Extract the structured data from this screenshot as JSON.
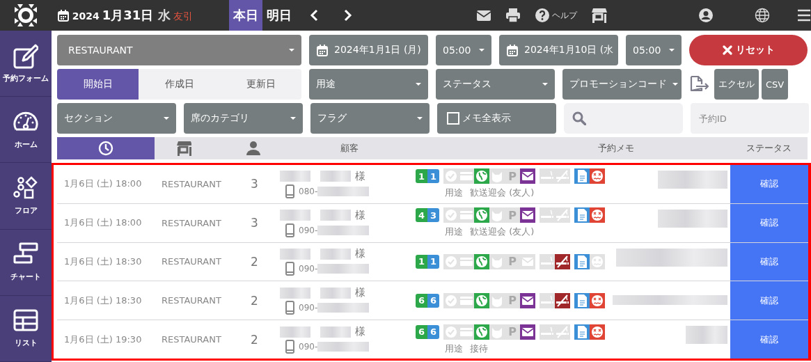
{
  "topbar": {
    "year": "2024",
    "date": "1月31日",
    "weekday": "水",
    "rokuyo": "友引",
    "day_buttons": [
      {
        "label": "本日",
        "selected": true
      },
      {
        "label": "明日",
        "selected": false
      }
    ],
    "help": "ヘルプ"
  },
  "sidebar": {
    "items": [
      {
        "kind": "form",
        "label": "予約フォーム"
      },
      {
        "kind": "home",
        "label": "ホーム"
      },
      {
        "kind": "floor",
        "label": "フロア"
      },
      {
        "kind": "chart",
        "label": "チャート"
      },
      {
        "kind": "list",
        "label": "リスト"
      }
    ]
  },
  "filters": {
    "section": "RESTAURANT",
    "start_date": "2024年1月1日 (月)",
    "start_time": "05:00",
    "end_date": "2024年1月10日 (水",
    "end_time": "05:00",
    "reset": "リセット",
    "date_types": [
      {
        "label": "開始日",
        "selected": true
      },
      {
        "label": "作成日",
        "selected": false
      },
      {
        "label": "更新日",
        "selected": false
      }
    ],
    "purpose": "用途",
    "status": "ステータス",
    "promotion": "プロモーションコード",
    "export_buttons": [
      "エクセル",
      "CSV"
    ],
    "seat_section": "セクション",
    "seat_category": "席のカテゴリ",
    "flag": "フラグ",
    "memo_toggle": {
      "label": "メモ全表示",
      "checked": false
    },
    "reservation_id": {
      "placeholder": "予約ID"
    }
  },
  "table": {
    "sort_tabs": [
      {
        "kind": "clock",
        "selected": true
      },
      {
        "kind": "store",
        "selected": false
      },
      {
        "kind": "person",
        "selected": false
      }
    ],
    "columns": [
      "顧客",
      "予約メモ",
      "ステータス"
    ],
    "rows": [
      {
        "datetime": "1月6日 (土) 18:00",
        "section": "RESTAURANT",
        "party": "3",
        "honorific": "様",
        "phone": "080-",
        "badges": [
          "1",
          "1"
        ],
        "flags": [
          {
            "kind": "check",
            "on": false
          },
          {
            "kind": "card",
            "on": false
          },
          {
            "kind": "globe",
            "on": true
          },
          {
            "kind": "cat",
            "on": false
          },
          {
            "kind": "parking",
            "symbol": "P",
            "on": false
          },
          {
            "kind": "mail",
            "on": true
          },
          {
            "kind": "smoking",
            "on": false
          },
          {
            "kind": "nosmoking",
            "on": false
          },
          {
            "kind": "document",
            "on": true
          },
          {
            "kind": "face",
            "on": true
          }
        ],
        "purpose_label": "用途",
        "purpose": "歓送迎会 (友人)",
        "status": "確認"
      },
      {
        "datetime": "1月6日 (土) 18:00",
        "section": "RESTAURANT",
        "party": "3",
        "honorific": "様",
        "phone": "090-",
        "badges": [
          "4",
          "3"
        ],
        "flags": [
          {
            "kind": "check",
            "on": false
          },
          {
            "kind": "card",
            "on": false
          },
          {
            "kind": "globe",
            "on": true
          },
          {
            "kind": "cat",
            "on": false
          },
          {
            "kind": "parking",
            "symbol": "P",
            "on": false
          },
          {
            "kind": "mail",
            "on": true
          },
          {
            "kind": "smoking",
            "on": false
          },
          {
            "kind": "nosmoking",
            "on": false
          },
          {
            "kind": "document",
            "on": true
          },
          {
            "kind": "face",
            "on": true
          }
        ],
        "purpose_label": "用途",
        "purpose": "歓送迎会 (友人)",
        "status": "確認"
      },
      {
        "datetime": "1月6日 (土) 18:30",
        "section": "RESTAURANT",
        "party": "2",
        "honorific": "様",
        "phone": "090-",
        "badges": [
          "1",
          "1"
        ],
        "flags": [
          {
            "kind": "check",
            "on": false
          },
          {
            "kind": "card",
            "on": false
          },
          {
            "kind": "globe",
            "on": true
          },
          {
            "kind": "cat",
            "on": false
          },
          {
            "kind": "parking",
            "symbol": "P",
            "on": false
          },
          {
            "kind": "mail",
            "on": false
          },
          {
            "kind": "smoking",
            "on": false
          },
          {
            "kind": "nosmoking",
            "on": true
          },
          {
            "kind": "document",
            "on": true
          },
          {
            "kind": "face",
            "on": false
          }
        ],
        "status": "確認"
      },
      {
        "datetime": "1月6日 (土) 18:30",
        "section": "RESTAURANT",
        "party": "2",
        "honorific": "様",
        "phone": "090-",
        "badges": [
          "6",
          "6"
        ],
        "flags": [
          {
            "kind": "check",
            "on": false
          },
          {
            "kind": "card",
            "on": false
          },
          {
            "kind": "globe",
            "on": true
          },
          {
            "kind": "cat",
            "on": false
          },
          {
            "kind": "parking",
            "symbol": "P",
            "on": false
          },
          {
            "kind": "mail",
            "on": true
          },
          {
            "kind": "smoking",
            "on": false
          },
          {
            "kind": "nosmoking",
            "on": true
          },
          {
            "kind": "document",
            "on": true
          },
          {
            "kind": "face",
            "on": true
          }
        ],
        "status": "確認"
      },
      {
        "datetime": "1月6日 (土) 19:30",
        "section": "RESTAURANT",
        "party": "2",
        "honorific": "様",
        "phone": "090-",
        "badges": [
          "6",
          "6"
        ],
        "flags": [
          {
            "kind": "check",
            "on": false
          },
          {
            "kind": "card",
            "on": false
          },
          {
            "kind": "globe",
            "on": true
          },
          {
            "kind": "cat",
            "on": false
          },
          {
            "kind": "parking",
            "symbol": "P",
            "on": false
          },
          {
            "kind": "mail",
            "on": true
          },
          {
            "kind": "smoking",
            "on": false
          },
          {
            "kind": "nosmoking",
            "on": false
          },
          {
            "kind": "document",
            "on": true
          },
          {
            "kind": "face",
            "on": true
          }
        ],
        "purpose_label": "用途",
        "purpose": "接待",
        "status": "確認"
      }
    ]
  }
}
